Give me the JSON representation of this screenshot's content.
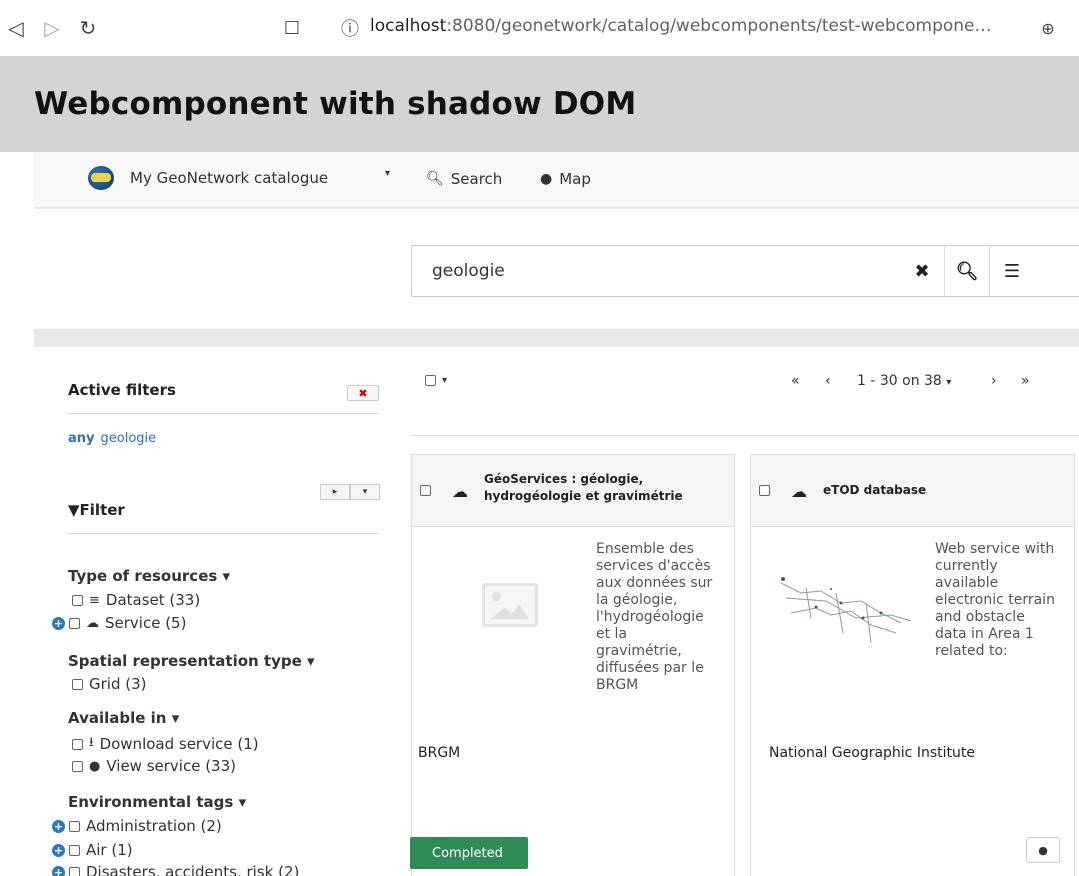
{
  "browser": {
    "url_host": "localhost",
    "url_rest": ":8080/geonetwork/catalog/webcomponents/test-webcompone…"
  },
  "page": {
    "title": "Webcomponent with shadow DOM"
  },
  "topnav": {
    "brand": "My GeoNetwork catalogue",
    "search_label": "Search",
    "map_label": "Map"
  },
  "search": {
    "value": "geologie"
  },
  "sidebar": {
    "active_filters_title": "Active filters",
    "any_label": "any",
    "any_value": "geologie",
    "filter_title": "Filter",
    "type_of_resources": {
      "title": "Type of resources",
      "items": [
        "Dataset (33)",
        "Service (5)"
      ]
    },
    "spatial_representation": {
      "title": "Spatial representation type",
      "items": [
        "Grid (3)"
      ]
    },
    "available_in": {
      "title": "Available in",
      "items": [
        "Download service (1)",
        "View service (33)"
      ]
    },
    "environmental_tags": {
      "title": "Environmental tags",
      "items": [
        "Administration (2)",
        "Air (1)",
        "Disasters, accidents, risk (2)"
      ]
    }
  },
  "results": {
    "pager_text": "1 - 30 on 38",
    "cards": [
      {
        "title": "GéoServices : géologie, hydrogéologie et gravimétrie",
        "description": "Ensemble des services d'accès aux données sur la géologie, l'hydrogéologie et la gravimétrie, diffusées par le BRGM",
        "organisation": "BRGM",
        "status": "Completed"
      },
      {
        "title": "eTOD database",
        "description": "Web service with currently available electronic terrain and obstacle data in Area 1 related to:",
        "organisation": "National Geographic Institute"
      }
    ]
  },
  "colors": {
    "header_bg": "#d4d4d4",
    "link_blue": "#2a6fcf",
    "status_green": "#2e8b57"
  }
}
